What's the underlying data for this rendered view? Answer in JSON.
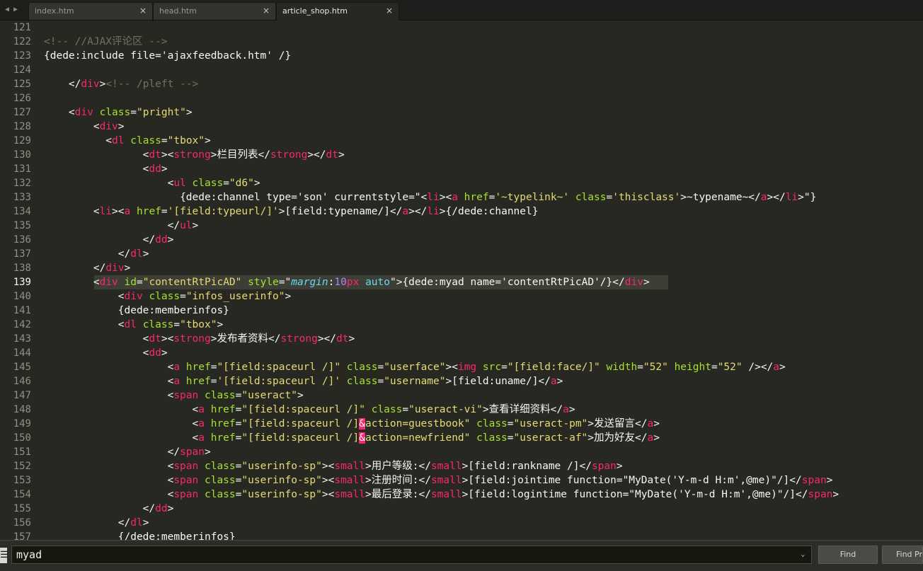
{
  "tabs": [
    {
      "label": "index.htm",
      "close": "×"
    },
    {
      "label": "head.htm",
      "close": "×"
    },
    {
      "label": "article_shop.htm",
      "close": "×"
    }
  ],
  "nav": {
    "back": "◀",
    "forward": "▶"
  },
  "editor": {
    "current_line": 139,
    "lines": [
      {
        "num": "121"
      },
      {
        "num": "122",
        "comment": "<!-- //AJAX评论区 -->"
      },
      {
        "num": "123",
        "text": "{dede:include file='ajaxfeedback.htm' /}"
      },
      {
        "num": "124"
      },
      {
        "num": "125",
        "tag": "div",
        "comment": "<!-- /pleft -->"
      },
      {
        "num": "126"
      },
      {
        "num": "127",
        "tag": "div",
        "attr": "class",
        "value": "\"pright\""
      },
      {
        "num": "128",
        "tag": "div"
      },
      {
        "num": "129",
        "tag": "dl",
        "attr": "class",
        "value": "\"tbox\""
      },
      {
        "num": "130",
        "tag": "dt",
        "inner_tag": "strong",
        "text": "栏目列表"
      },
      {
        "num": "131",
        "tag": "dd"
      },
      {
        "num": "132",
        "tag": "ul",
        "attr": "class",
        "value": "\"d6\""
      },
      {
        "num": "133",
        "text_a": "{dede:channel type='son' currentstyle=\"",
        "tag": "li",
        "inner_tag": "a",
        "attr": "href",
        "value": "'~typelink~'",
        "attr2": "class",
        "value2": "'thisclass'",
        "text": "~typename~",
        "text_b": "\"}"
      },
      {
        "num": "134",
        "tag": "li",
        "inner_tag": "a",
        "attr": "href",
        "value": "'[field:typeurl/]'",
        "text": "[field:typename/]",
        "text_b": "{/dede:channel}"
      },
      {
        "num": "135",
        "tag": "ul"
      },
      {
        "num": "136",
        "tag": "dd"
      },
      {
        "num": "137",
        "tag": "dl"
      },
      {
        "num": "138",
        "tag": "div"
      },
      {
        "num": "139",
        "tag": "div",
        "attr": "id",
        "value": "\"contentRtPicAD\"",
        "attr2": "style",
        "prop": "margin",
        "num_val": "10",
        "unit": "px",
        "kw": "auto",
        "text": "{dede:myad name='contentRtPicAD'/}"
      },
      {
        "num": "140",
        "tag": "div",
        "attr": "class",
        "value": "\"infos_userinfo\""
      },
      {
        "num": "141",
        "text": "{dede:memberinfos}"
      },
      {
        "num": "142",
        "tag": "dl",
        "attr": "class",
        "value": "\"tbox\""
      },
      {
        "num": "143",
        "tag": "dt",
        "inner_tag": "strong",
        "text": "发布者资料"
      },
      {
        "num": "144",
        "tag": "dd"
      },
      {
        "num": "145",
        "tag": "a",
        "attr": "href",
        "value": "\"[field:spaceurl /]\"",
        "attr2": "class",
        "value2": "\"userface\"",
        "inner_tag": "img",
        "attr3": "src",
        "value3": "\"[field:face/]\"",
        "attr4": "width",
        "value4": "\"52\"",
        "attr5": "height",
        "value5": "\"52\""
      },
      {
        "num": "146",
        "tag": "a",
        "attr": "href",
        "value": "'[field:spaceurl /]'",
        "attr2": "class",
        "value2": "\"username\"",
        "text": "[field:uname/]"
      },
      {
        "num": "147",
        "tag": "span",
        "attr": "class",
        "value": "\"useract\""
      },
      {
        "num": "148",
        "tag": "a",
        "attr": "href",
        "value": "\"[field:spaceurl /]\"",
        "attr2": "class",
        "value2": "\"useract-vi\"",
        "text": "查看详细资料"
      },
      {
        "num": "149",
        "tag": "a",
        "attr": "href",
        "value": "\"[field:spaceurl /]",
        "amp": "&",
        "value_b": "action=guestbook\"",
        "attr2": "class",
        "value2": "\"useract-pm\"",
        "text": "发送留言"
      },
      {
        "num": "150",
        "tag": "a",
        "attr": "href",
        "value": "\"[field:spaceurl /]",
        "amp": "&",
        "value_b": "action=newfriend\"",
        "attr2": "class",
        "value2": "\"useract-af\"",
        "text": "加为好友"
      },
      {
        "num": "151",
        "tag": "span"
      },
      {
        "num": "152",
        "tag": "span",
        "attr": "class",
        "value": "\"userinfo-sp\"",
        "inner_tag": "small",
        "text": "用户等级:",
        "text_b": "[field:rankname /]"
      },
      {
        "num": "153",
        "tag": "span",
        "attr": "class",
        "value": "\"userinfo-sp\"",
        "inner_tag": "small",
        "text": "注册时间:",
        "text_b": "[field:jointime function=\"MyDate('Y-m-d H:m',@me)\"/]"
      },
      {
        "num": "154",
        "tag": "span",
        "attr": "class",
        "value": "\"userinfo-sp\"",
        "inner_tag": "small",
        "text": "最后登录:",
        "text_b": "[field:logintime function=\"MyDate('Y-m-d H:m',@me)\"/]"
      },
      {
        "num": "155",
        "tag": "dd"
      },
      {
        "num": "156",
        "tag": "dl"
      },
      {
        "num": "157",
        "text": "{/dede:memberinfos}"
      }
    ]
  },
  "find": {
    "icon": "☰",
    "query": "myad",
    "dropdown": "⌄",
    "find_label": "Find",
    "find_prev_label": "Find Prev"
  }
}
